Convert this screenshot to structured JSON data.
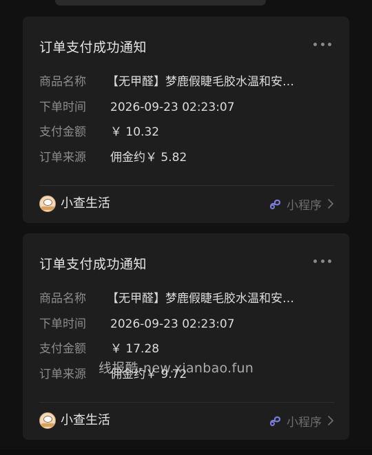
{
  "cards": [
    {
      "title": "订单支付成功通知",
      "rows": [
        {
          "label": "商品名称",
          "value": "【无甲醛】梦鹿假睫毛胶水温和安…"
        },
        {
          "label": "下单时间",
          "value": "2026-09-23 02:23:07"
        },
        {
          "label": "支付金额",
          "value": "￥ 10.32"
        },
        {
          "label": "订单来源",
          "value": "佣金约￥ 5.82"
        }
      ],
      "footer": {
        "app_name": "小查生活",
        "mini_program_label": "小程序"
      }
    },
    {
      "title": "订单支付成功通知",
      "rows": [
        {
          "label": "商品名称",
          "value": "【无甲醛】梦鹿假睫毛胶水温和安…"
        },
        {
          "label": "下单时间",
          "value": "2026-09-23 02:23:07"
        },
        {
          "label": "支付金额",
          "value": "￥ 17.28"
        },
        {
          "label": "订单来源",
          "value": "佣金约￥ 9.72"
        }
      ],
      "footer": {
        "app_name": "小查生活",
        "mini_program_label": "小程序"
      }
    }
  ],
  "watermark": "线报酷-new.xianbao.fun",
  "colors": {
    "background": "#111111",
    "card": "#1e1e1e",
    "mini_program_accent": "#7b7bd9"
  },
  "icons": {
    "more": "more-dots-icon",
    "mini_program": "mini-program-icon",
    "chevron": "chevron-right-icon",
    "avatar": "app-avatar"
  }
}
